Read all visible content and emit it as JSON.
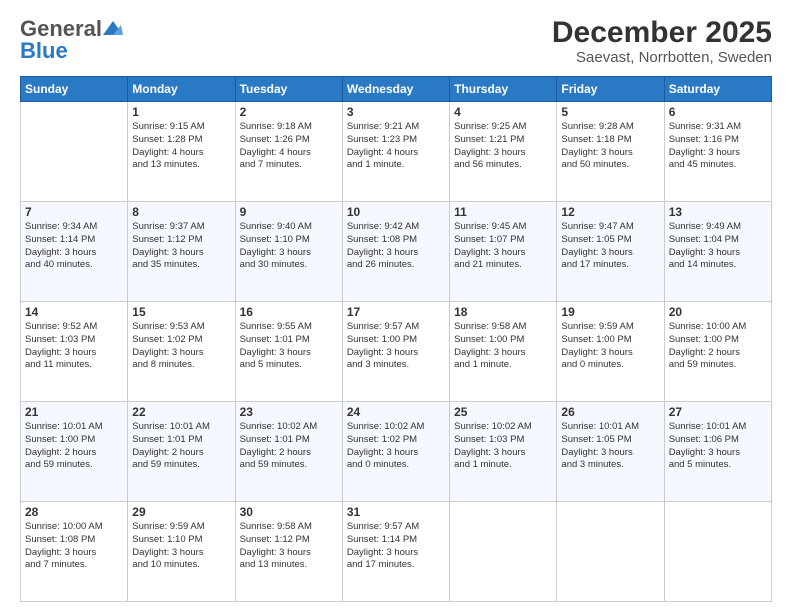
{
  "logo": {
    "general": "General",
    "blue": "Blue"
  },
  "title": "December 2025",
  "subtitle": "Saevast, Norrbotten, Sweden",
  "days": [
    "Sunday",
    "Monday",
    "Tuesday",
    "Wednesday",
    "Thursday",
    "Friday",
    "Saturday"
  ],
  "weeks": [
    [
      {
        "day": "",
        "info": ""
      },
      {
        "day": "1",
        "info": "Sunrise: 9:15 AM\nSunset: 1:28 PM\nDaylight: 4 hours\nand 13 minutes."
      },
      {
        "day": "2",
        "info": "Sunrise: 9:18 AM\nSunset: 1:26 PM\nDaylight: 4 hours\nand 7 minutes."
      },
      {
        "day": "3",
        "info": "Sunrise: 9:21 AM\nSunset: 1:23 PM\nDaylight: 4 hours\nand 1 minute."
      },
      {
        "day": "4",
        "info": "Sunrise: 9:25 AM\nSunset: 1:21 PM\nDaylight: 3 hours\nand 56 minutes."
      },
      {
        "day": "5",
        "info": "Sunrise: 9:28 AM\nSunset: 1:18 PM\nDaylight: 3 hours\nand 50 minutes."
      },
      {
        "day": "6",
        "info": "Sunrise: 9:31 AM\nSunset: 1:16 PM\nDaylight: 3 hours\nand 45 minutes."
      }
    ],
    [
      {
        "day": "7",
        "info": "Sunrise: 9:34 AM\nSunset: 1:14 PM\nDaylight: 3 hours\nand 40 minutes."
      },
      {
        "day": "8",
        "info": "Sunrise: 9:37 AM\nSunset: 1:12 PM\nDaylight: 3 hours\nand 35 minutes."
      },
      {
        "day": "9",
        "info": "Sunrise: 9:40 AM\nSunset: 1:10 PM\nDaylight: 3 hours\nand 30 minutes."
      },
      {
        "day": "10",
        "info": "Sunrise: 9:42 AM\nSunset: 1:08 PM\nDaylight: 3 hours\nand 26 minutes."
      },
      {
        "day": "11",
        "info": "Sunrise: 9:45 AM\nSunset: 1:07 PM\nDaylight: 3 hours\nand 21 minutes."
      },
      {
        "day": "12",
        "info": "Sunrise: 9:47 AM\nSunset: 1:05 PM\nDaylight: 3 hours\nand 17 minutes."
      },
      {
        "day": "13",
        "info": "Sunrise: 9:49 AM\nSunset: 1:04 PM\nDaylight: 3 hours\nand 14 minutes."
      }
    ],
    [
      {
        "day": "14",
        "info": "Sunrise: 9:52 AM\nSunset: 1:03 PM\nDaylight: 3 hours\nand 11 minutes."
      },
      {
        "day": "15",
        "info": "Sunrise: 9:53 AM\nSunset: 1:02 PM\nDaylight: 3 hours\nand 8 minutes."
      },
      {
        "day": "16",
        "info": "Sunrise: 9:55 AM\nSunset: 1:01 PM\nDaylight: 3 hours\nand 5 minutes."
      },
      {
        "day": "17",
        "info": "Sunrise: 9:57 AM\nSunset: 1:00 PM\nDaylight: 3 hours\nand 3 minutes."
      },
      {
        "day": "18",
        "info": "Sunrise: 9:58 AM\nSunset: 1:00 PM\nDaylight: 3 hours\nand 1 minute."
      },
      {
        "day": "19",
        "info": "Sunrise: 9:59 AM\nSunset: 1:00 PM\nDaylight: 3 hours\nand 0 minutes."
      },
      {
        "day": "20",
        "info": "Sunrise: 10:00 AM\nSunset: 1:00 PM\nDaylight: 2 hours\nand 59 minutes."
      }
    ],
    [
      {
        "day": "21",
        "info": "Sunrise: 10:01 AM\nSunset: 1:00 PM\nDaylight: 2 hours\nand 59 minutes."
      },
      {
        "day": "22",
        "info": "Sunrise: 10:01 AM\nSunset: 1:01 PM\nDaylight: 2 hours\nand 59 minutes."
      },
      {
        "day": "23",
        "info": "Sunrise: 10:02 AM\nSunset: 1:01 PM\nDaylight: 2 hours\nand 59 minutes."
      },
      {
        "day": "24",
        "info": "Sunrise: 10:02 AM\nSunset: 1:02 PM\nDaylight: 3 hours\nand 0 minutes."
      },
      {
        "day": "25",
        "info": "Sunrise: 10:02 AM\nSunset: 1:03 PM\nDaylight: 3 hours\nand 1 minute."
      },
      {
        "day": "26",
        "info": "Sunrise: 10:01 AM\nSunset: 1:05 PM\nDaylight: 3 hours\nand 3 minutes."
      },
      {
        "day": "27",
        "info": "Sunrise: 10:01 AM\nSunset: 1:06 PM\nDaylight: 3 hours\nand 5 minutes."
      }
    ],
    [
      {
        "day": "28",
        "info": "Sunrise: 10:00 AM\nSunset: 1:08 PM\nDaylight: 3 hours\nand 7 minutes."
      },
      {
        "day": "29",
        "info": "Sunrise: 9:59 AM\nSunset: 1:10 PM\nDaylight: 3 hours\nand 10 minutes."
      },
      {
        "day": "30",
        "info": "Sunrise: 9:58 AM\nSunset: 1:12 PM\nDaylight: 3 hours\nand 13 minutes."
      },
      {
        "day": "31",
        "info": "Sunrise: 9:57 AM\nSunset: 1:14 PM\nDaylight: 3 hours\nand 17 minutes."
      },
      {
        "day": "",
        "info": ""
      },
      {
        "day": "",
        "info": ""
      },
      {
        "day": "",
        "info": ""
      }
    ]
  ]
}
